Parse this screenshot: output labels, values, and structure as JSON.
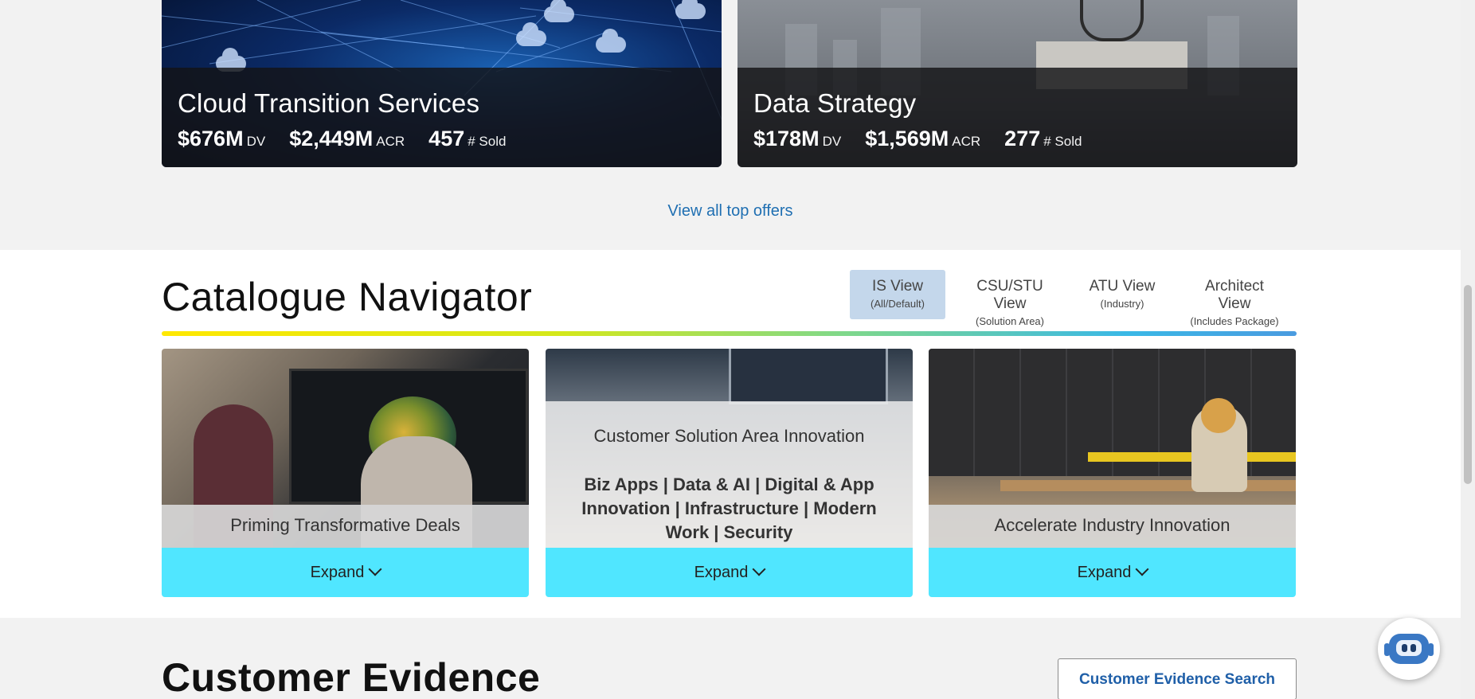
{
  "top_offers": {
    "cards": [
      {
        "title": "Cloud Transition Services",
        "stats": [
          {
            "value": "$676M",
            "unit": "DV"
          },
          {
            "value": "$2,449M",
            "unit": "ACR"
          },
          {
            "value": "457",
            "unit": "# Sold"
          }
        ]
      },
      {
        "title": "Data Strategy",
        "stats": [
          {
            "value": "$178M",
            "unit": "DV"
          },
          {
            "value": "$1,569M",
            "unit": "ACR"
          },
          {
            "value": "277",
            "unit": "# Sold"
          }
        ]
      }
    ],
    "view_all_label": "View all top offers"
  },
  "navigator": {
    "title": "Catalogue Navigator",
    "views": [
      {
        "name": "IS View",
        "sub": "(All/Default)",
        "active": true
      },
      {
        "name": "CSU/STU View",
        "sub": "(Solution Area)",
        "active": false
      },
      {
        "name": "ATU View",
        "sub": "(Industry)",
        "active": false
      },
      {
        "name": "Architect View",
        "sub": "(Includes Package)",
        "active": false
      }
    ],
    "cards": [
      {
        "label": "Priming Transformative Deals",
        "expand_label": "Expand"
      },
      {
        "label": "Customer Solution Area Innovation",
        "body": "Biz Apps | Data & AI | Digital & App Innovation | Infrastructure | Modern Work | Security",
        "expand_label": "Expand"
      },
      {
        "label": "Accelerate Industry Innovation",
        "expand_label": "Expand"
      }
    ],
    "accent_color": "#50e6ff"
  },
  "evidence": {
    "title": "Customer Evidence",
    "search_button_label": "Customer Evidence Search"
  },
  "icons": {
    "chatbot": "robot-chat-icon",
    "expand": "chevron-down-icon"
  }
}
